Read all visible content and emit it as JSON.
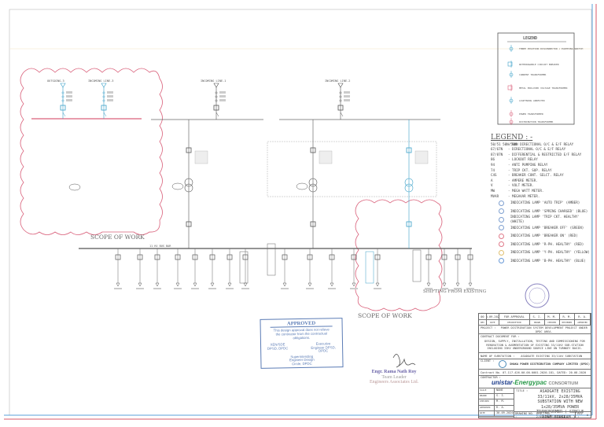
{
  "incomers": [
    {
      "label": "OUTGOING-3"
    },
    {
      "label": "INCOMING LINE-3"
    },
    {
      "label": "INCOMING LINE-1"
    },
    {
      "label": "INCOMING LINE-2"
    }
  ],
  "scope_labels": [
    "SCOPE OF WORK",
    "SCOPE OF WORK"
  ],
  "shifting_label": "SHIFTING FROM EXISTING",
  "bus_label": "11 KV BUS BAR",
  "symbol_legend": {
    "title": "LEGEND",
    "items": [
      "THREE POSITION DISCONNECTOR / EARTHING SWITCH",
      "WITHDRAWABLE CIRCUIT BREAKER",
      "CURRENT TRANSFORMER",
      "METAL ENCLOSED VOLTAGE TRANSFORMER",
      "LIGHTNING ARRESTER",
      "POWER TRANSFORMER",
      "DISTRIBUTION TRANSFORMER"
    ]
  },
  "relay_legend": {
    "title": "LEGEND : -",
    "items": [
      {
        "code": "50/51 50N/51N",
        "desc": "NON DIRECTIONAL O/C & E/F RELAY"
      },
      {
        "code": "67/67N",
        "desc": "DIRECTIONAL O/C & E/F RELAY"
      },
      {
        "code": "87/87N",
        "desc": "DIFFERENTIAL & RESTRICTED E/F RELAY"
      },
      {
        "code": "86",
        "desc": "LOCKOUT RELAY"
      },
      {
        "code": "94",
        "desc": "ANTI PUMPING RELAY"
      },
      {
        "code": "74",
        "desc": "TRIP CKT. SUP. RELAY"
      },
      {
        "code": "C4S",
        "desc": "BREAKER CONT. SELCT. RELAY"
      },
      {
        "code": "A",
        "desc": "AMPERE METER."
      },
      {
        "code": "V",
        "desc": "VOLT METER."
      },
      {
        "code": "MW",
        "desc": "MEGA WATT METER."
      },
      {
        "code": "MVAR",
        "desc": "MEGAVAR METER."
      }
    ],
    "lamps": [
      {
        "desc": "INDICATING LAMP 'AUTO TRIP' (AMBER)",
        "color": "#7fa0d0"
      },
      {
        "desc": "INDICATING LAMP 'SPRING CHARGED' (BLUE)",
        "color": "#7fa0d0"
      },
      {
        "desc": "INDICATING LAMP 'TRIP CKT. HEALTHY' (WHITE)",
        "color": "#7fa0d0"
      },
      {
        "desc": "INDICATING LAMP 'BREAKER OFF' (GREEN)",
        "color": "#7fa0d0"
      },
      {
        "desc": "INDICATING LAMP 'BREAKER ON' (RED)",
        "color": "#e07a8a"
      },
      {
        "desc": "INDICATING LAMP 'R-PH. HEALTHY' (RED)",
        "color": "#e07a8a"
      },
      {
        "desc": "INDICATING LAMP 'Y-PH. HEALTHY' (YELLOW)",
        "color": "#e0c070"
      },
      {
        "desc": "INDICATING LAMP 'B-PH. HEALTHY' (BLUE)",
        "color": "#6a9ad8"
      }
    ]
  },
  "title_block": {
    "rev_row": [
      "00",
      "30.09.2020",
      "FOR APPROVAL",
      "S. I.",
      "M. M.",
      "R. M.",
      "R. A."
    ],
    "header_row": [
      "REV",
      "DATE",
      "DESCRIPTION",
      "DRAWN",
      "CHECKED",
      "REVIEWED",
      "APPROVED"
    ],
    "project_label": "PROJECT :",
    "project": "POWER DISTRIBUTION SYSTEM DEVELOPMENT PROJECT UNDER DPDC AREA.",
    "contract_label": "CONTRACT DOCUMENT FOR :",
    "contract": "DESIGN, SUPPLY, INSTALLATION, TESTING AND COMMISSIONING FOR RENOVATION & AUGMENTATION OF EXISTING 33/11KV SUB-STATION INCLUDING 33KV UNDERGROUND SOURCE LINE ON TURNKEY BASIS.",
    "substation_label": "NAME OF SUBSTATION :",
    "substation": "ASADGATE EXISTING 33/11kV SUBSTATION",
    "client_label": "CLIENT :",
    "client": "DHAKA POWER DISTRIBUTION COMPANY LIMITED (DPDC)",
    "contract_no": "Contract No. 07.117.426.00.00.0001.2020.181, DATED: 20.08.2020",
    "contractor_label": "CONTRACTOR :",
    "contractor_a": "unistar",
    "contractor_b": "-Energypac",
    "consortium": "CONSORTIUM",
    "scale_label": "SCALE",
    "scale": "NONE",
    "drawn_label": "DRAWN",
    "drawn": "S. I.",
    "checked_label": "CHECKED",
    "checked": "M. M.",
    "approved_label": "APPROVED",
    "approved": "R. A.",
    "date_label": "DATE",
    "date": "30.09.2020",
    "title_label": "TITLE :",
    "title": "ASADGATE EXISTING 33/11kV, 2x28/35MVA SUBSTATION WITH NEW 1x28/35MVA POWER TRANSFORMER ( SINGLE LINE DIAGRAM ).",
    "drawing_no_label": "DRAWING NO. :",
    "drawing_no": "DPDC/PKG-2/ASADGATE/SLD/E1",
    "rev_label": "REV :",
    "rev": "A"
  },
  "approval_stamp": {
    "heading": "APPROVED",
    "note": "This design approval does not relieve the contractor from the contractual obligations.",
    "sig1": "XEN/SDE DPSD, DPDC",
    "sig2": "Executive Engineer DPSD, DPDC",
    "sig3": "Superintending Engineer Design Circle, DPDC"
  },
  "engineer": {
    "name": "Engr. Rama Nath Roy",
    "role": "Team Leader",
    "org": "Engineers Associates Ltd."
  },
  "colors": {
    "cloud": "#d9607a",
    "border_blue": "#5aa0d8",
    "border_red": "#d85a6a",
    "new": "#3aa0c8"
  }
}
